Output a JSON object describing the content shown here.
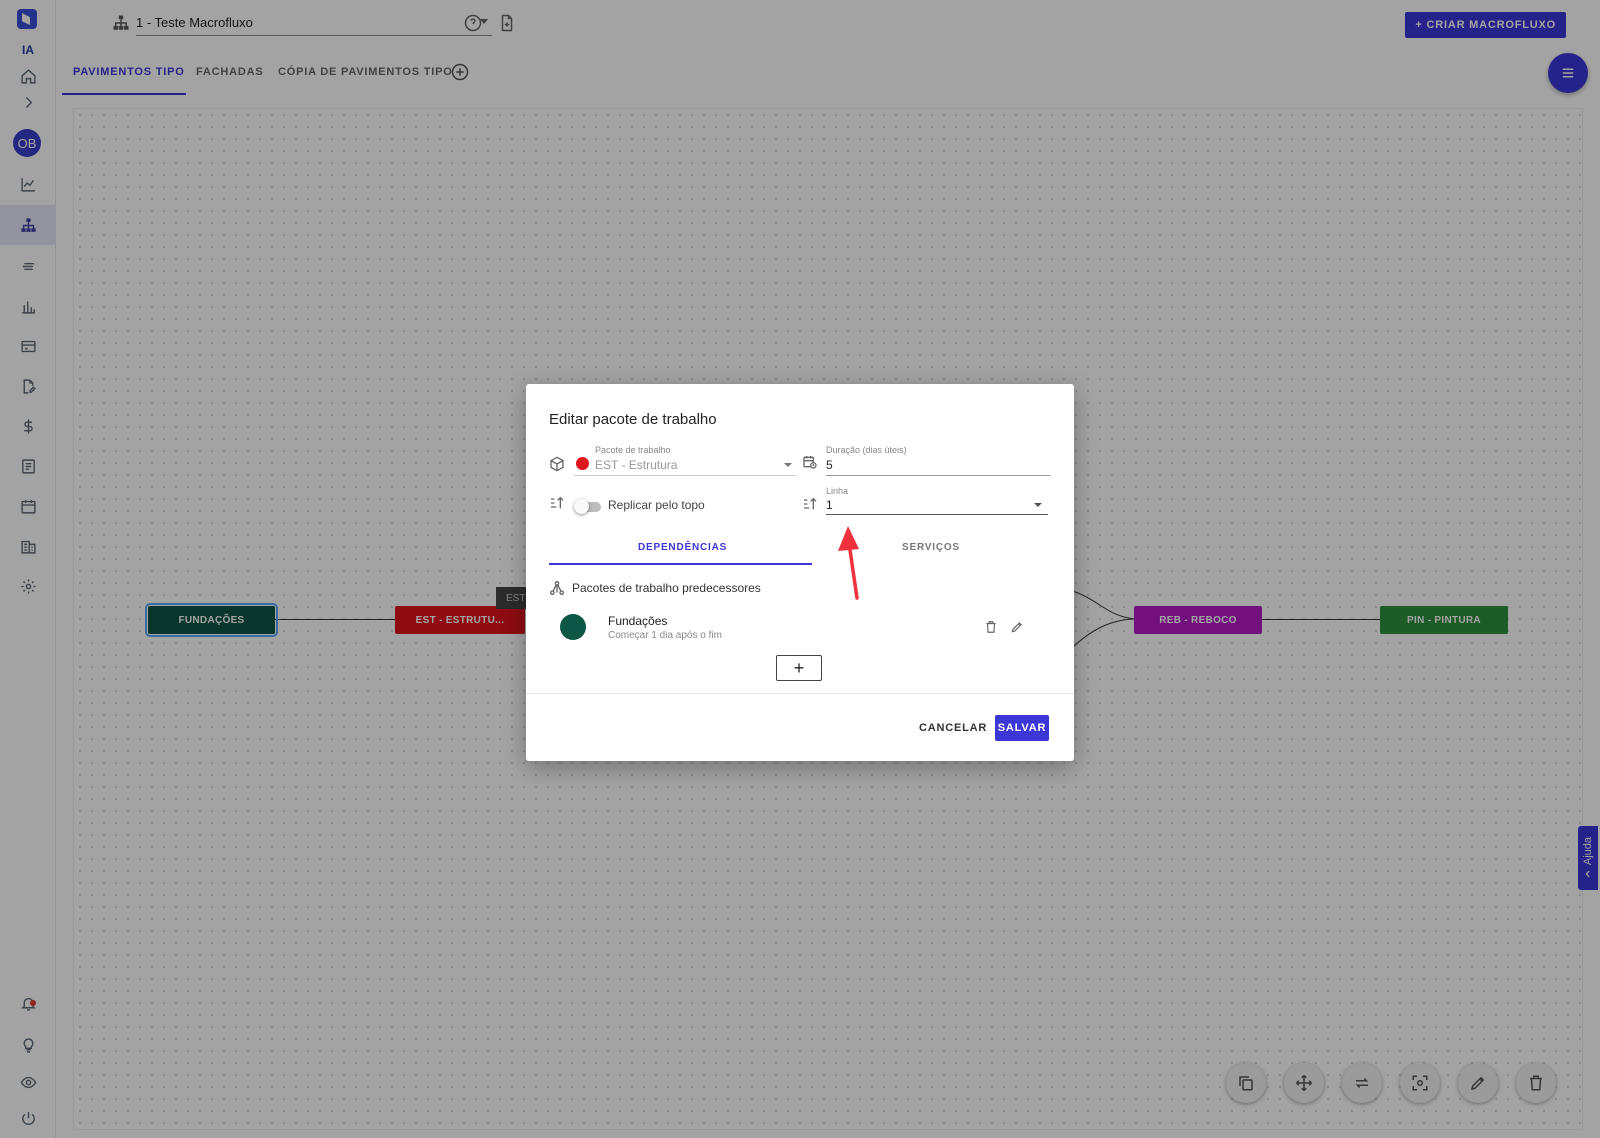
{
  "header": {
    "macrofluxo_value": "1 - Teste Macrofluxo",
    "criar_label": "+ CRIAR MACROFLUXO"
  },
  "sidebar": {
    "ia_label": "IA",
    "avatar_initials": "OB"
  },
  "tabs": [
    {
      "label": "PAVIMENTOS TIPO",
      "active": true
    },
    {
      "label": "FACHADAS",
      "active": false
    },
    {
      "label": "CÓPIA DE PAVIMENTOS TIPO",
      "active": false
    }
  ],
  "nodes": [
    {
      "label": "FUNDAÇÕES",
      "color": "#0d5545"
    },
    {
      "label": "EST - ESTRUTU...",
      "color": "#e0141e"
    },
    {
      "label": "REB - REBOCO",
      "color": "#b21bc4"
    },
    {
      "label": "PIN - PINTURA",
      "color": "#2e8f3e"
    }
  ],
  "est_tag": "EST",
  "help_label": "Ajuda",
  "modal": {
    "title": "Editar pacote de trabalho",
    "pacote_label": "Pacote de trabalho",
    "pacote_value": "EST - Estrutura",
    "pacote_color": "#e0141e",
    "duracao_label": "Duração (dias úteis)",
    "duracao_value": "5",
    "replicar_label": "Replicar pelo topo",
    "replicar_on": false,
    "linha_label": "Linha",
    "linha_value": "1",
    "tabs": [
      "DEPENDÊNCIAS",
      "SERVIÇOS"
    ],
    "pred_label": "Pacotes de trabalho predecessores",
    "dependency": {
      "name": "Fundações",
      "detail": "Começar 1 dia após o fim",
      "color": "#0d5545"
    },
    "add_label": "+",
    "cancel_label": "CANCELAR",
    "save_label": "SALVAR"
  },
  "colors": {
    "accent": "#3b36d6",
    "annotation_arrow": "#f0303c"
  }
}
